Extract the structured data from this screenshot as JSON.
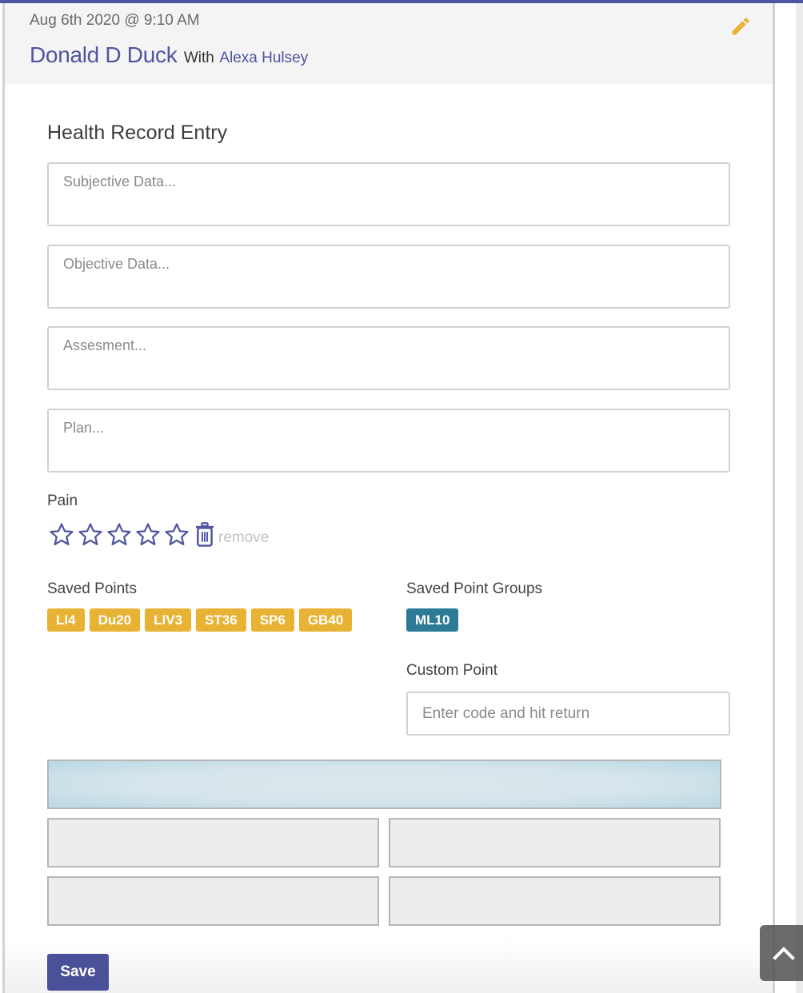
{
  "header": {
    "date": "Aug 6th 2020 @ 9:10 AM",
    "patient_name": "Donald D Duck",
    "with_label": "With",
    "practitioner_name": "Alexa Hulsey",
    "edit_icon": "pencil-icon"
  },
  "form": {
    "title": "Health Record Entry",
    "fields": {
      "subjective": {
        "placeholder": "Subjective Data...",
        "value": ""
      },
      "objective": {
        "placeholder": "Objective Data...",
        "value": ""
      },
      "assessment": {
        "placeholder": "Assesment...",
        "value": ""
      },
      "plan": {
        "placeholder": "Plan...",
        "value": ""
      }
    },
    "pain": {
      "label": "Pain",
      "rating": 0,
      "max_rating": 5,
      "star_icon": "star-outline-icon",
      "trash_icon": "trash-icon",
      "remove_label": "remove"
    },
    "saved_points": {
      "label": "Saved Points",
      "items": [
        "LI4",
        "Du20",
        "LIV3",
        "ST36",
        "SP6",
        "GB40"
      ],
      "color": "#e8b234"
    },
    "saved_point_groups": {
      "label": "Saved Point Groups",
      "items": [
        "ML10"
      ],
      "color": "#2d7a96"
    },
    "custom_point": {
      "label": "Custom Point",
      "placeholder": "Enter code and hit return",
      "value": ""
    },
    "save_label": "Save"
  },
  "colors": {
    "accent": "#4f55a0",
    "edit_icon": "#e8b234",
    "save_button": "#4a5199"
  },
  "scroll_top_icon": "chevron-up-icon"
}
